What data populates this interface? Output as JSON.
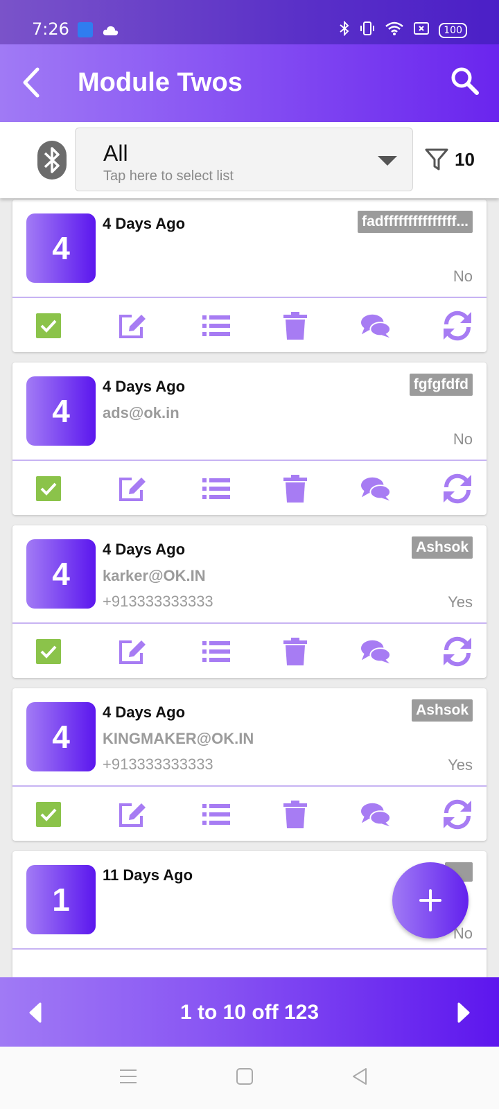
{
  "status": {
    "time": "7:26",
    "battery": "100"
  },
  "appbar": {
    "title": "Module Twos"
  },
  "filterbar": {
    "select_value": "All",
    "select_hint": "Tap here to select list",
    "filter_count": "10"
  },
  "cards": [
    {
      "badge": "4",
      "when": "4 Days Ago",
      "email": "",
      "phone": "",
      "tag": "fadfffffffffffffff...",
      "flag": "No"
    },
    {
      "badge": "4",
      "when": "4 Days Ago",
      "email": "ads@ok.in",
      "phone": "",
      "tag": "fgfgfdfd",
      "flag": "No"
    },
    {
      "badge": "4",
      "when": "4 Days Ago",
      "email": "karker@OK.IN",
      "phone": "+913333333333",
      "tag": "Ashsok",
      "flag": "Yes"
    },
    {
      "badge": "4",
      "when": "4 Days Ago",
      "email": "KINGMAKER@OK.IN",
      "phone": "+913333333333",
      "tag": "Ashsok",
      "flag": "Yes"
    },
    {
      "badge": "1",
      "when": "11 Days Ago",
      "email": "",
      "phone": "",
      "tag": "",
      "flag": "No"
    }
  ],
  "pager": {
    "label": "1 to 10 off 123"
  },
  "colors": {
    "accent": "#8a57f3",
    "accent_dark": "#5b17ee",
    "icon": "#a77cf3",
    "check": "#8bc34a",
    "tag_bg": "#9b9b9b"
  }
}
